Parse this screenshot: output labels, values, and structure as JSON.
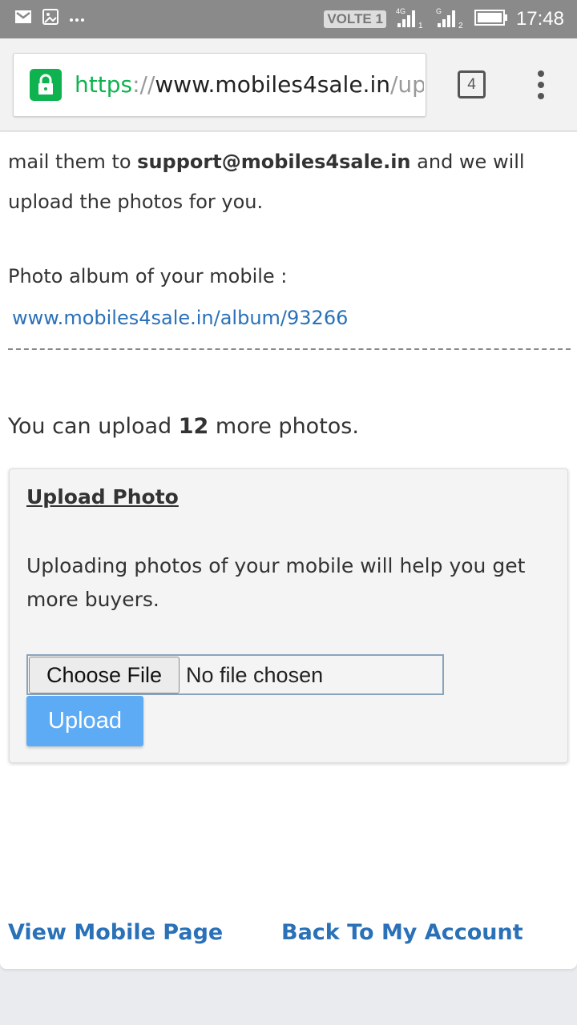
{
  "status_bar": {
    "network_label": "VOLTE 1",
    "signal_1_type": "4G",
    "signal_1_sim": "1",
    "signal_2_type": "G",
    "signal_2_sim": "2",
    "time": "17:48",
    "left_icons": [
      "gmail-icon",
      "gallery-icon",
      "more-notifications-icon"
    ]
  },
  "browser": {
    "url_scheme": "https",
    "url_sep": "://",
    "url_host": "www.mobiles4sale.in",
    "url_path": "/upc",
    "tab_count": "4",
    "accent_secure": "#0eb34f"
  },
  "content": {
    "intro_prefix": "mail them to ",
    "support_email": "support@mobiles4sale.in",
    "intro_suffix": " and we will upload the photos for you.",
    "album_label": "Photo album of your mobile :",
    "album_link": "www.mobiles4sale.in/album/93266",
    "remaining_prefix": "You can upload ",
    "remaining_count": "12",
    "remaining_suffix": " more photos.",
    "upload_box": {
      "title": "Upload Photo",
      "description": "Uploading photos of your mobile will help you get more buyers.",
      "choose_file_label": "Choose File",
      "no_file_text": "No file chosen",
      "upload_button": "Upload"
    },
    "footer": {
      "view_mobile_page": "View Mobile Page",
      "back_to_account": "Back To My Account"
    },
    "link_color": "#2a71b8",
    "button_color": "#5eabf5"
  }
}
